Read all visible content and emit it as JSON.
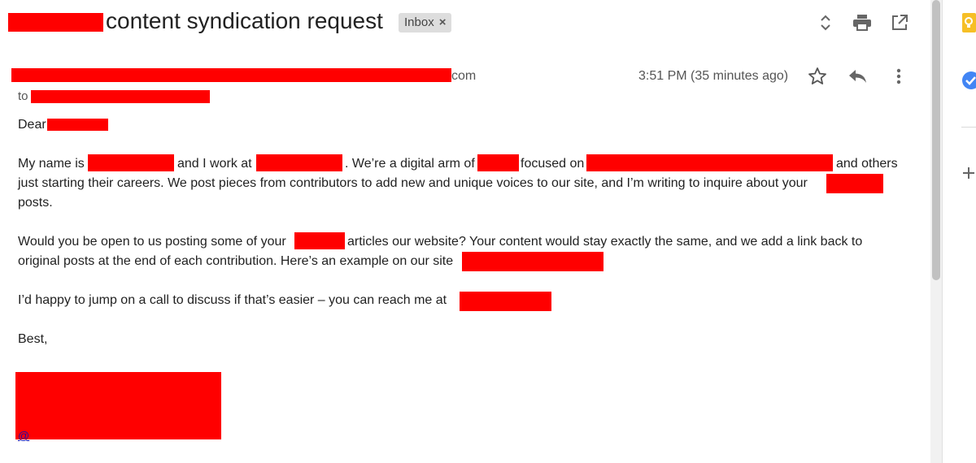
{
  "email": {
    "subject": "content syndication request",
    "label_badge": "Inbox",
    "label_remove": "×",
    "sender_suffix": "com",
    "to_label": "to",
    "timestamp": "3:51 PM (35 minutes ago)"
  },
  "body": {
    "greeting": "Dear",
    "p1_line1_a": "My name is",
    "p1_line1_b": "and I work at",
    "p1_line1_c": ". We’re a digital arm of",
    "p1_line1_d": "focused on",
    "p1_line1_e": "and others",
    "p1_line2": "just starting their careers. We post pieces from contributors to add new and unique voices to our site, and I’m writing to inquire about your",
    "p1_line3": "posts.",
    "p2_line1_a": "Would you be open to us posting some of your",
    "p2_line1_b": "articles our website? Your content would stay exactly the same, and we add a link back to",
    "p2_line2": "original posts at the end of each contribution. Here’s an example on our site",
    "p3": "I’d happy to jump on a call to discuss if that’s easier – you can reach me at",
    "closing": "Best,",
    "signature_link": "@"
  },
  "icons": {
    "nav": "chevron-up-down-icon",
    "print": "print-icon",
    "popout": "open-in-new-window-icon",
    "star": "star-icon",
    "reply": "reply-icon",
    "more": "more-vert-icon",
    "keep": "keep-icon",
    "tasks": "tasks-icon",
    "add": "add-icon"
  },
  "colors": {
    "redaction": "#ff0000",
    "keep_yellow": "#f6bf26",
    "tasks_blue": "#4285f4"
  }
}
